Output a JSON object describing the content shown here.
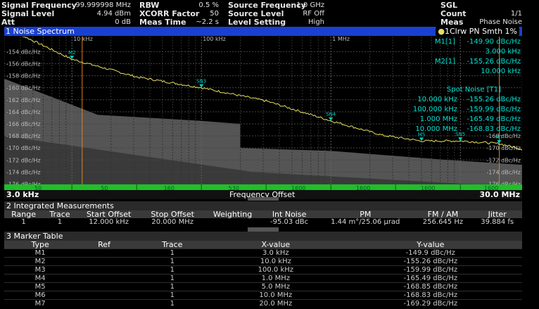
{
  "header": {
    "col1": [
      {
        "label": "Signal Frequency",
        "value": "99.999998 MHz"
      },
      {
        "label": "Signal Level",
        "value": "4.94 dBm"
      },
      {
        "label": "Att",
        "value": "0 dB"
      }
    ],
    "col2": [
      {
        "label": "RBW",
        "value": "0.5 %"
      },
      {
        "label": "XCORR Factor",
        "value": "50"
      },
      {
        "label": "Meas Time",
        "value": "~2.2 s"
      }
    ],
    "col3": [
      {
        "label": "Source Frequency",
        "value": "1.0 GHz"
      },
      {
        "label": "Source Level",
        "value": "RF Off"
      },
      {
        "label": "Level Setting",
        "value": "High"
      }
    ],
    "col4": [
      {
        "label": "SGL",
        "value": ""
      },
      {
        "label": "Count",
        "value": "1/1"
      },
      {
        "label": "Meas",
        "value": "Phase Noise"
      }
    ]
  },
  "spectrum": {
    "title": "1 Noise Spectrum",
    "trace_label": "1Clrw PN Smth 1%",
    "x_start": "3.0 kHz",
    "x_end": "30.0 MHz",
    "x_axis_label": "Frequency Offset",
    "decade_labels": [
      "10 kHz",
      "100 kHz",
      "1 MHz"
    ],
    "y_ticks": [
      "-154 dBc/Hz",
      "-156 dBc/Hz",
      "-158 dBc/Hz",
      "-160 dBc/Hz",
      "-162 dBc/Hz",
      "-164 dBc/Hz",
      "-166 dBc/Hz",
      "-168 dBc/Hz",
      "-170 dBc/Hz",
      "-172 dBc/Hz",
      "-174 dBc/Hz",
      "-176 dBc/Hz"
    ],
    "y_ticks_right": [
      "-168 dBc/Hz",
      "-170 dBc/Hz",
      "-172 dBc/Hz",
      "-174 dBc/Hz",
      "-176 dBc/Hz"
    ],
    "green_bar_labels": [
      "50",
      "50",
      "160",
      "530",
      "1600",
      "1600",
      "1600",
      "1600"
    ],
    "readouts": [
      {
        "name": "M1[1]",
        "value": "-149.90 dBc/Hz",
        "freq": "3.000 kHz"
      },
      {
        "name": "M2[1]",
        "value": "-155.26 dBc/Hz",
        "freq": "10.000 kHz"
      }
    ],
    "spot_noise_title": "Spot Noise [T1]",
    "spot_noise": [
      {
        "freq": "10.000 kHz",
        "value": "-155.26 dBc/Hz"
      },
      {
        "freq": "100.000 kHz",
        "value": "-159.99 dBc/Hz"
      },
      {
        "freq": "1.000 MHz",
        "value": "-165.49 dBc/Hz"
      },
      {
        "freq": "10.000 MHz",
        "value": "-168.83 dBc/Hz"
      }
    ],
    "markers": [
      {
        "label": "M2",
        "sn": "SN2",
        "x_log": 4.0,
        "y": -155.26
      },
      {
        "label": "SN3",
        "x_log": 5.0,
        "y": -159.99
      },
      {
        "label": "SN4",
        "x_log": 6.0,
        "y": -165.49
      },
      {
        "label": "M5",
        "x_log": 6.7,
        "y": -168.85
      },
      {
        "label": "SN5",
        "x_log": 7.0,
        "y": -168.83
      },
      {
        "label": "M7",
        "x_log": 7.3,
        "y": -169.29
      }
    ],
    "colors": {
      "trace": "#e8e060",
      "marker": "#00d0c0",
      "readout": "#00e0d0",
      "green": "#1fbf2a",
      "title_bar": "#1a40d0"
    }
  },
  "integrated": {
    "title": "2 Integrated Measurements",
    "headers": [
      "Range",
      "Trace",
      "Start Offset",
      "Stop Offset",
      "Weighting",
      "Int Noise",
      "PM",
      "FM / AM",
      "Jitter"
    ],
    "rows": [
      [
        "1",
        "1",
        "12.000 kHz",
        "20.000 MHz",
        "",
        "-95.03 dBc",
        "1.44 m°/25.06 µrad",
        "256.645 Hz",
        "39.884 fs"
      ]
    ]
  },
  "marker_table": {
    "title": "3 Marker Table",
    "headers": [
      "Type",
      "Ref",
      "Trace",
      "X-value",
      "Y-value"
    ],
    "rows": [
      [
        "M1",
        "",
        "1",
        "3.0 kHz",
        "-149.9 dBc/Hz"
      ],
      [
        "M2",
        "",
        "1",
        "10.0 kHz",
        "-155.26 dBc/Hz"
      ],
      [
        "M3",
        "",
        "1",
        "100.0 kHz",
        "-159.99 dBc/Hz"
      ],
      [
        "M4",
        "",
        "1",
        "1.0 MHz",
        "-165.49 dBc/Hz"
      ],
      [
        "M5",
        "",
        "1",
        "5.0 MHz",
        "-168.85 dBc/Hz"
      ],
      [
        "M6",
        "",
        "1",
        "10.0 MHz",
        "-168.83 dBc/Hz"
      ],
      [
        "M7",
        "",
        "1",
        "20.0 MHz",
        "-169.29 dBc/Hz"
      ]
    ]
  }
}
